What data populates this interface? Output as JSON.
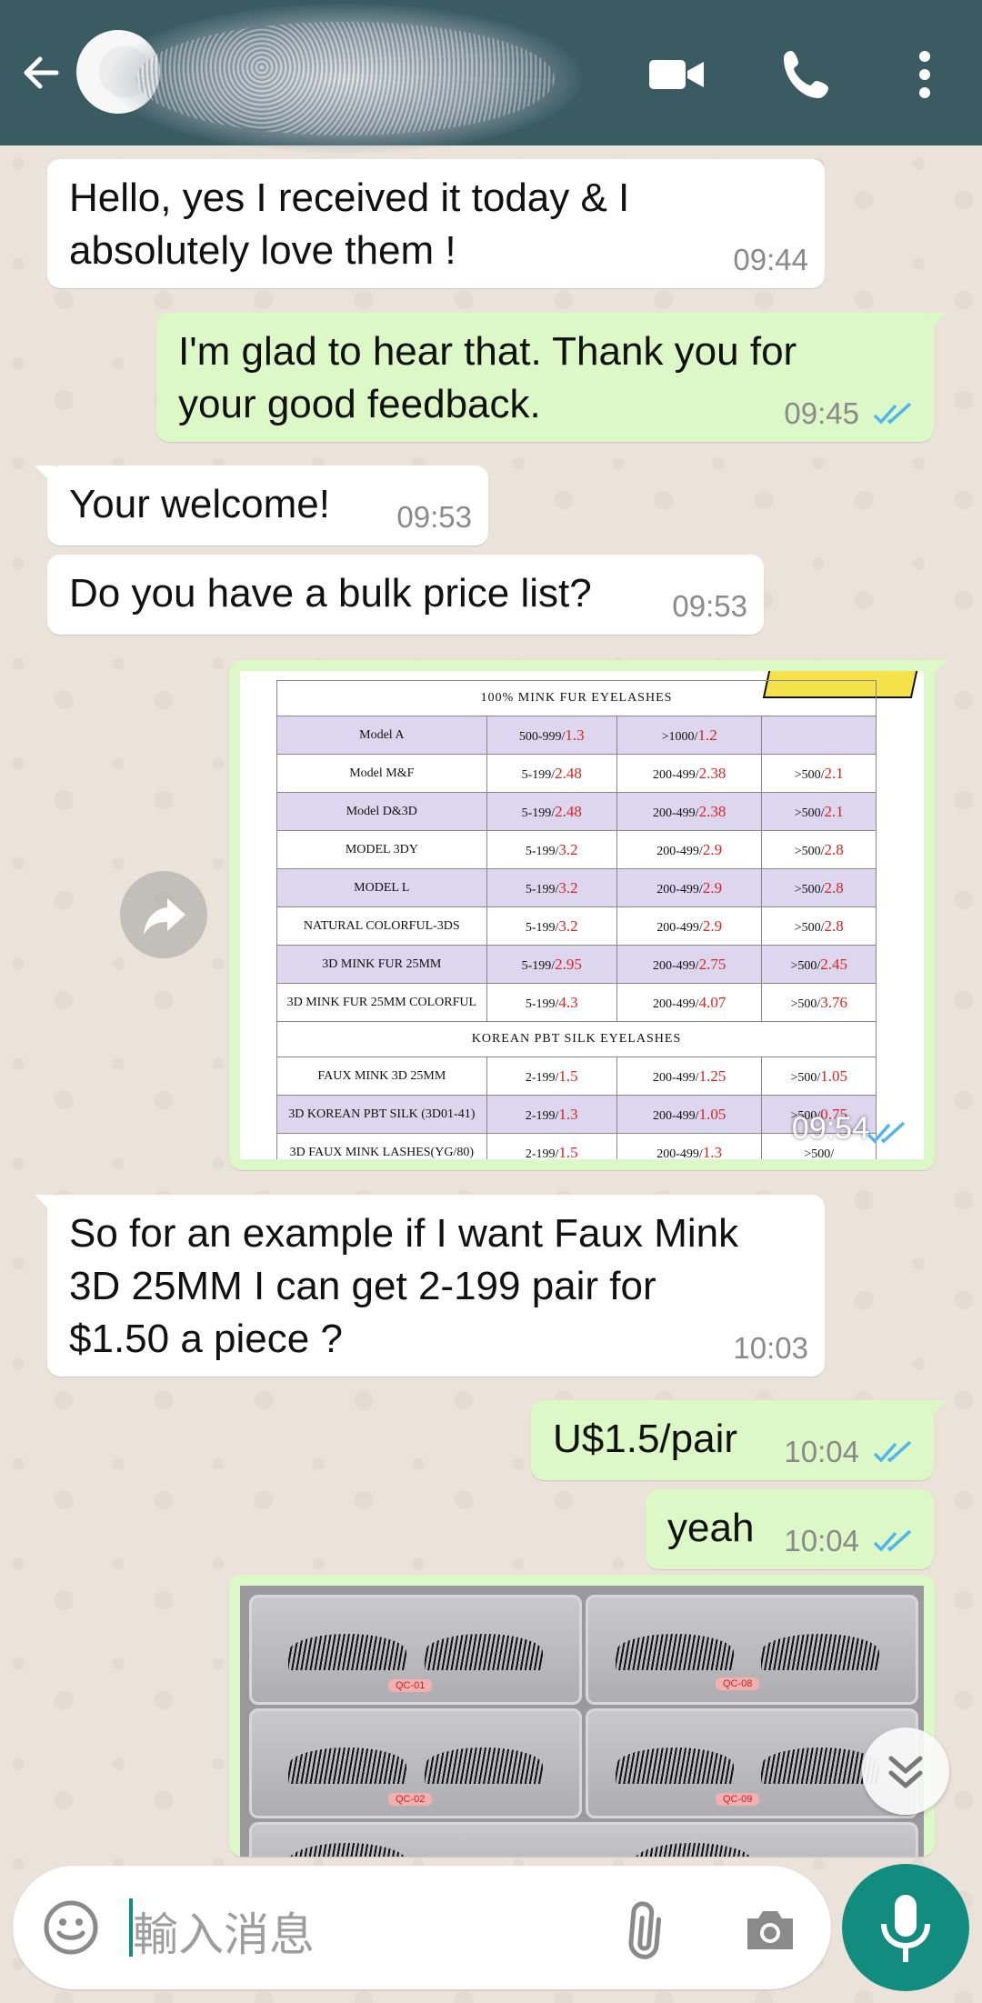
{
  "header": {
    "contact_name": "",
    "icons": [
      "back-arrow-icon",
      "video-call-icon",
      "phone-icon",
      "more-vertical-icon"
    ]
  },
  "messages": [
    {
      "dir": "in",
      "text": "Hello, yes I received it today & I\nabsolutely love them !",
      "time": "09:44"
    },
    {
      "dir": "out",
      "text": "I'm glad to hear that. Thank you for\nyour good feedback.",
      "time": "09:45"
    },
    {
      "dir": "in",
      "text": "Your welcome!",
      "time": "09:53"
    },
    {
      "dir": "in",
      "text": "Do you have a bulk price list?",
      "time": "09:53"
    },
    {
      "dir": "out",
      "type": "image",
      "time": "09:54"
    },
    {
      "dir": "in",
      "text": "So for an example if I want Faux Mink\n3D 25MM I can get 2-199 pair for\n$1.50 a piece ?",
      "time": "10:03"
    },
    {
      "dir": "out",
      "text": "U$1.5/pair",
      "time": "10:04"
    },
    {
      "dir": "out",
      "text": "yeah",
      "time": "10:04"
    },
    {
      "dir": "out",
      "type": "image"
    }
  ],
  "price_table": {
    "section1": "100%   MINK   FUR   EYELASHES",
    "section2": "KOREAN   PBT   SILK   EYELASHES",
    "rows1": [
      {
        "model": "Model A",
        "c1": "500-999/",
        "v1": "1.3",
        "c2": ">1000/",
        "v2": "1.2",
        "c3": "",
        "v3": ""
      },
      {
        "model": "Model M&F",
        "c1": "5-199/",
        "v1": "2.48",
        "c2": "200-499/",
        "v2": "2.38",
        "c3": ">500/",
        "v3": "2.1"
      },
      {
        "model": "Model D&3D",
        "c1": "5-199/",
        "v1": "2.48",
        "c2": "200-499/",
        "v2": "2.38",
        "c3": ">500/",
        "v3": "2.1"
      },
      {
        "model": "MODEL 3DY",
        "c1": "5-199/",
        "v1": "3.2",
        "c2": "200-499/",
        "v2": "2.9",
        "c3": ">500/",
        "v3": "2.8"
      },
      {
        "model": "MODEL L",
        "c1": "5-199/",
        "v1": "3.2",
        "c2": "200-499/",
        "v2": "2.9",
        "c3": ">500/",
        "v3": "2.8"
      },
      {
        "model": "NATURAL COLORFUL-3DS",
        "c1": "5-199/",
        "v1": "3.2",
        "c2": "200-499/",
        "v2": "2.9",
        "c3": ">500/",
        "v3": "2.8"
      },
      {
        "model": "3D MINK FUR 25MM",
        "c1": "5-199/",
        "v1": "2.95",
        "c2": "200-499/",
        "v2": "2.75",
        "c3": ">500/",
        "v3": "2.45"
      },
      {
        "model": "3D MINK FUR 25MM COLORFUL",
        "c1": "5-199/",
        "v1": "4.3",
        "c2": "200-499/",
        "v2": "4.07",
        "c3": ">500/",
        "v3": "3.76"
      }
    ],
    "rows2": [
      {
        "model": "FAUX MINK 3D 25MM",
        "c1": "2-199/",
        "v1": "1.5",
        "c2": "200-499/",
        "v2": "1.25",
        "c3": ">500/",
        "v3": "1.05"
      },
      {
        "model": "3D KOREAN PBT SILK (3D01-41)",
        "c1": "2-199/",
        "v1": "1.3",
        "c2": "200-499/",
        "v2": "1.05",
        "c3": ">500/",
        "v3": "0.75"
      },
      {
        "model": "3D FAUX MINK LASHES(YG/80)",
        "c1": "2-199/",
        "v1": "1.5",
        "c2": "200-499/",
        "v2": "1.3",
        "c3": ">500/",
        "v3": ""
      }
    ]
  },
  "lash_tags": [
    "QC-01",
    "QC-08",
    "QC-02",
    "QC-09"
  ],
  "composer": {
    "placeholder": "輸入消息"
  },
  "colors": {
    "header": "#3b5b63",
    "outgoing": "#dcf8c6",
    "incoming": "#ffffff",
    "accent": "#128c7e",
    "read_ticks": "#4fb6ec"
  }
}
